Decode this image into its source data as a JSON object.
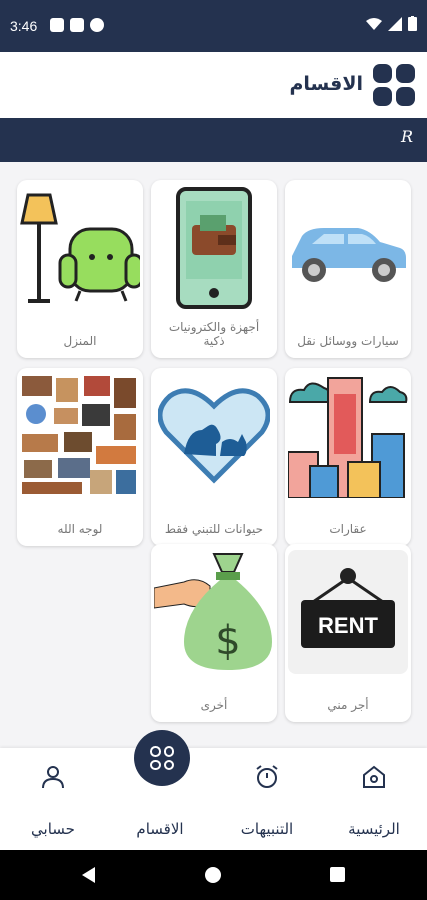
{
  "status_bar": {
    "time": "3:46"
  },
  "header": {
    "title": "الاقسام",
    "logo_text": "R"
  },
  "categories": [
    {
      "label": "سيارات ووسائل نقل",
      "icon": "car-icon"
    },
    {
      "label": "أجهزة والكترونيات ذكية",
      "icon": "wallet-phone-icon"
    },
    {
      "label": "المنزل",
      "icon": "furniture-icon"
    },
    {
      "label": "عقارات",
      "icon": "buildings-icon"
    },
    {
      "label": "حيوانات للتبني فقط",
      "icon": "pets-heart-icon"
    },
    {
      "label": "لوجه الله",
      "icon": "donated-furniture-image"
    },
    {
      "label": "أجر مني",
      "icon": "rent-sign-icon"
    },
    {
      "label": "أخرى",
      "icon": "money-bag-icon"
    }
  ],
  "rent_sign_text": "RENT",
  "bottom_nav": [
    {
      "label": "الرئيسية",
      "icon": "home-icon"
    },
    {
      "label": "التنبيهات",
      "icon": "alarm-icon"
    },
    {
      "label": "الاقسام",
      "icon": "grid-icon"
    },
    {
      "label": "حسابي",
      "icon": "person-icon"
    }
  ],
  "colors": {
    "primary": "#24324f",
    "background": "#f4f4f6",
    "card": "#ffffff"
  }
}
